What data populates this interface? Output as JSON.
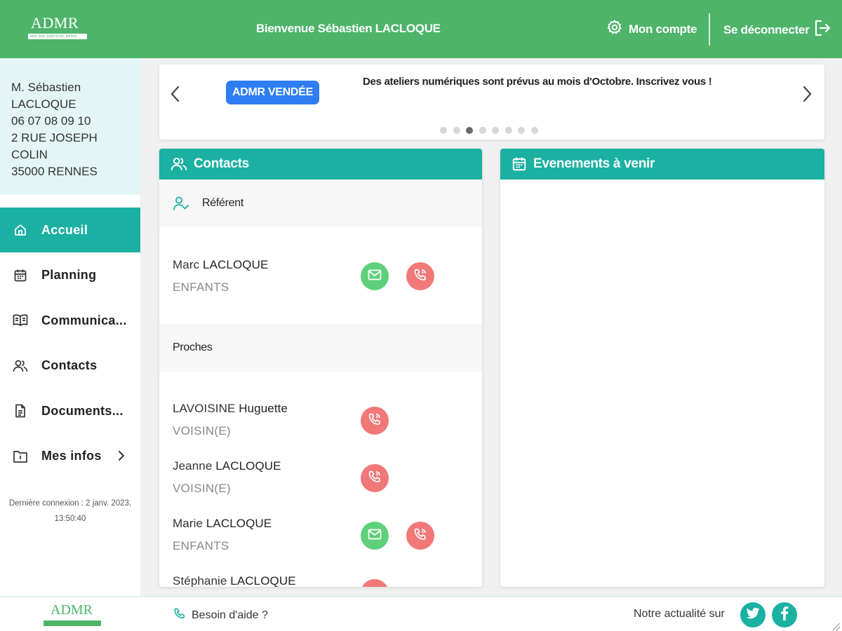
{
  "header": {
    "logo_text": "ADMR",
    "logo_tagline": "pour tous, toute la vie, partout",
    "welcome": "Bienvenue Sébastien LACLOQUE",
    "account_label": "Mon compte",
    "logout_label": "Se déconnecter"
  },
  "user": {
    "name_line1": "M. Sébastien",
    "name_line2": "LACLOQUE",
    "phone": "06 07 08 09 10",
    "address_line1": "2 RUE JOSEPH",
    "address_line2": "COLIN",
    "address_line3": "35000 RENNES"
  },
  "nav": {
    "items": [
      {
        "label": "Accueil",
        "icon": "home-icon",
        "active": true
      },
      {
        "label": "Planning",
        "icon": "calendar-icon"
      },
      {
        "label": "Communica...",
        "icon": "book-icon"
      },
      {
        "label": "Contacts",
        "icon": "people-icon"
      },
      {
        "label": "Documents...",
        "icon": "document-icon"
      },
      {
        "label": "Mes infos",
        "icon": "folder-info-icon"
      }
    ]
  },
  "last_login": {
    "line1": "Dernière connexion : 2 janv. 2023,",
    "line2": "13:50:40"
  },
  "carousel": {
    "badge": "ADMR VENDÉE",
    "message": "Des ateliers numériques sont prévus au mois d'Octobre. Inscrivez vous !",
    "dot_count": 8,
    "active_dot": 3
  },
  "contacts_panel": {
    "title": "Contacts",
    "referent_header": "Référent",
    "proches_header": "Proches",
    "referent": {
      "first": "Marc",
      "last": "LACLOQUE",
      "relation": "ENFANTS"
    },
    "proches": [
      {
        "first": "LAVOISINE",
        "last": "Huguette",
        "relation": "VOISIN(E)"
      },
      {
        "first": "Jeanne",
        "last": "LACLOQUE",
        "relation": "VOISIN(E)"
      },
      {
        "first": "Marie",
        "last": "LACLOQUE",
        "relation": "ENFANTS"
      },
      {
        "first": "Stéphanie",
        "last": "LACLOQUE",
        "relation": ""
      }
    ]
  },
  "events_panel": {
    "title": "Evenements à venir"
  },
  "footer": {
    "help_label": "Besoin d'aide ?",
    "news_label": "Notre actualité sur"
  },
  "colors": {
    "header_green": "#4db46a",
    "teal": "#1ab0a2",
    "badge_blue": "#2e7df3",
    "mail_green": "#5fd07a",
    "phone_red": "#f07878"
  }
}
